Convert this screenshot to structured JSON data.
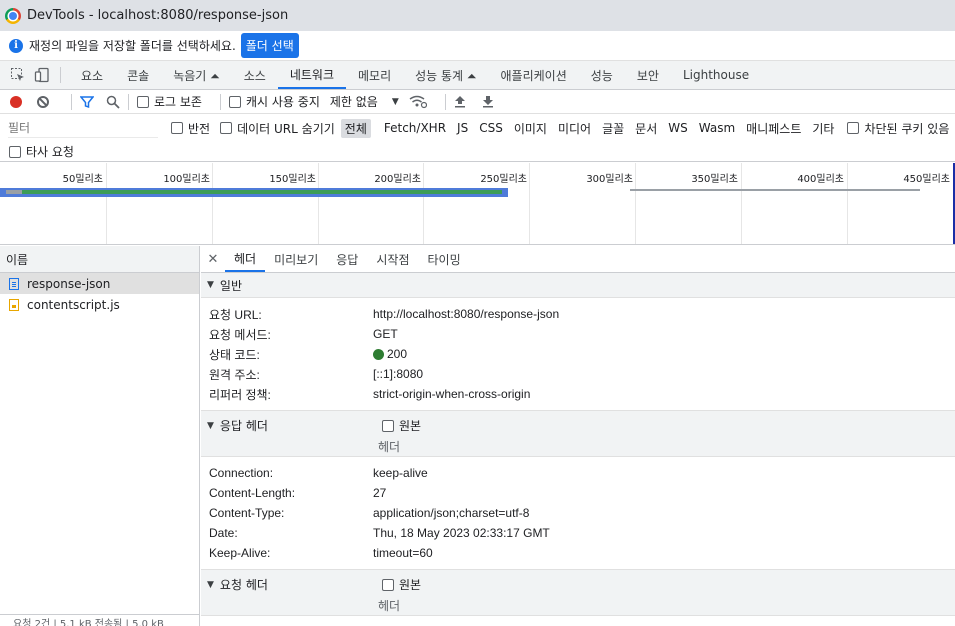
{
  "window": {
    "title": "DevTools - localhost:8080/response-json"
  },
  "infobar": {
    "message": "재정의 파일을 저장할 폴더를 선택하세요.",
    "button": "폴더 선택"
  },
  "tabs": [
    "요소",
    "콘솔",
    "녹음기 ⏶",
    "소스",
    "네트워크",
    "메모리",
    "성능 통계 ⏶",
    "애플리케이션",
    "성능",
    "보안",
    "Lighthouse"
  ],
  "active_tab": "네트워크",
  "toolbar": {
    "preserve_log": "로그 보존",
    "disable_cache": "캐시 사용 중지",
    "throttle": "제한 없음"
  },
  "filter": {
    "placeholder": "필터",
    "invert": "반전",
    "hide_data_urls": "데이터 URL 숨기기",
    "types": [
      "전체",
      "Fetch/XHR",
      "JS",
      "CSS",
      "이미지",
      "미디어",
      "글꼴",
      "문서",
      "WS",
      "Wasm",
      "매니페스트",
      "기타"
    ],
    "active_type": "전체",
    "blocked_cookies": "차단된 쿠키 있음",
    "third_party": "타사 요청"
  },
  "overview": {
    "tick_labels": [
      "50밀리초",
      "100밀리초",
      "150밀리초",
      "200밀리초",
      "250밀리초",
      "300밀리초",
      "350밀리초",
      "400밀리초",
      "450밀리초"
    ]
  },
  "requests": {
    "header": "이름",
    "items": [
      {
        "name": "response-json",
        "icon": "document-icon",
        "selected": true
      },
      {
        "name": "contentscript.js",
        "icon": "script-icon",
        "selected": false
      }
    ],
    "status": "요청 2건 | 5.1 kB 전송됨 | 5.0 kB"
  },
  "detail": {
    "tabs": [
      "헤더",
      "미리보기",
      "응답",
      "시작점",
      "타이밍"
    ],
    "active_tab": "헤더",
    "general": {
      "title": "일반",
      "rows": [
        {
          "key": "요청 URL:",
          "value": "http://localhost:8080/response-json"
        },
        {
          "key": "요청 메서드:",
          "value": "GET"
        },
        {
          "key": "상태 코드:",
          "value": "200"
        },
        {
          "key": "원격 주소:",
          "value": "[::1]:8080"
        },
        {
          "key": "리퍼러 정책:",
          "value": "strict-origin-when-cross-origin"
        }
      ]
    },
    "response_headers": {
      "title": "응답 헤더",
      "raw": "원본",
      "sub": "헤더",
      "rows": [
        {
          "key": "Connection:",
          "value": "keep-alive"
        },
        {
          "key": "Content-Length:",
          "value": "27"
        },
        {
          "key": "Content-Type:",
          "value": "application/json;charset=utf-8"
        },
        {
          "key": "Date:",
          "value": "Thu, 18 May 2023 02:33:17 GMT"
        },
        {
          "key": "Keep-Alive:",
          "value": "timeout=60"
        }
      ]
    },
    "request_headers": {
      "title": "요청 헤더",
      "raw": "원본",
      "sub": "헤더"
    }
  }
}
